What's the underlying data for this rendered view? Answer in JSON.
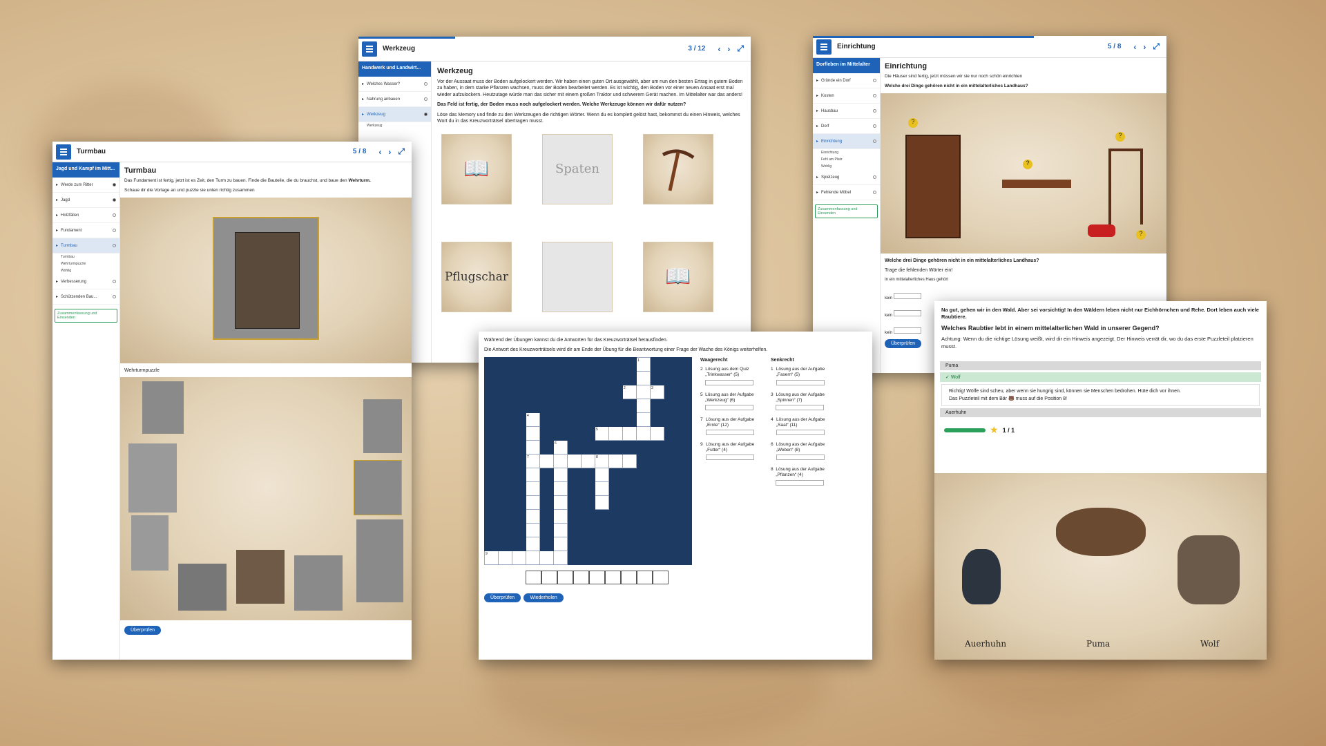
{
  "w1": {
    "title": "Turmbau",
    "counter": "5 / 8",
    "side_top": "Jagd und Kampf im Mitt...",
    "items": [
      "Werde zum Ritter",
      "Jagd",
      "Holzfällen",
      "Fundament",
      "Turmbau",
      "Verbesserung",
      "Schützenden Bau..."
    ],
    "subs": [
      "Turmbau",
      "Wehrturmpuzzle",
      "Wohlig"
    ],
    "summary": "Zusammenfassung und Einsenden",
    "heading": "Turmbau",
    "text1": "Das Fundament ist fertig, jetzt ist es Zeit, den Turm zu bauen. Finde die Bauteile, die du brauchst, und baue den",
    "text1b": "Wehrturm.",
    "text2": "Schaue dir die Vorlage an und puzzle sie unten richtig zusammen",
    "caption": "Wehrturmpuzzle",
    "check": "Überprüfen"
  },
  "w2": {
    "title": "Werkzeug",
    "counter": "3 / 12",
    "side_top": "Handwerk und Landwirt...",
    "items": [
      "Welches Wasser?",
      "Nahrung anbauen",
      "Werkzeug"
    ],
    "subs": [
      "Werkzeug"
    ],
    "heading": "Werkzeug",
    "text1": "Vor der Aussaat muss der Boden aufgelockert werden. Wir haben einen guten Ort ausgewählt, aber um nun den besten Ertrag in gutem Boden zu haben, in dem starke Pflanzen wachsen, muss der Boden bearbeitet werden. Es ist wichtig, den Boden vor einer neuen Ansaat erst mal wieder aufzulockern. Heutzutage würde man das sicher mit einem großen Traktor und schwerem Gerät machen. Im Mittelalter war das anders!",
    "text2": "Das Feld ist fertig, der Boden muss noch aufgelockert werden. Welche Werkzeuge können wir dafür nutzen?",
    "text3": "Löse das Memory und finde zu den Werkzeugen die richtigen Wörter. Wenn du es komplett gelöst hast, bekommst du einen Hinweis, welches Wort du in das Kreuzworträtsel übertragen musst.",
    "card_spaten": "Spaten",
    "card_pflugschar": "Pflugschar"
  },
  "w3": {
    "title": "Einrichtung",
    "counter": "5 / 8",
    "side_top": "Dorfleben im Mittelalter",
    "items": [
      "Gründe ein Dorf",
      "Kosten",
      "Hausbau",
      "Dorf",
      "Einrichtung",
      "Spielzeug",
      "Fehlende Möbel"
    ],
    "subs": [
      "Einrichtung",
      "Fehl am Platz",
      "Wohlig"
    ],
    "summary": "Zusammenfassung und Einsenden",
    "heading": "Einrichtung",
    "text1": "Die Häuser sind fertig, jetzt müssen wir sie nur noch schön einrichten",
    "q": "Welche drei Dinge gehören nicht in ein mittelalterliches Landhaus?",
    "q2": "Welche drei Dinge gehören nicht in ein mittelalterliches Landhaus?",
    "fill": "Trage die fehlenden Wörter ein!",
    "line": "In ein mittelalterliches Haus gehört",
    "kein": "kein",
    "check": "Überprüfen"
  },
  "w4": {
    "text1": "Während der Übungen kannst du die Antworten für das Kreuzworträtsel herausfinden.",
    "text2": "Die Antwort des Kreuzworträtsels wird dir am Ende der Übung für die Beantwortung einer Frage der Wache des Königs weiterhelfen.",
    "across_h": "Waagerecht",
    "down_h": "Senkrecht",
    "across": [
      [
        "2",
        "Lösung aus dem Quiz „Trinkwasser“ (5)"
      ],
      [
        "5",
        "Lösung aus der Aufgabe „Werkzeug“ (6)"
      ],
      [
        "7",
        "Lösung aus der Aufgabe „Ernte“ (12)"
      ],
      [
        "9",
        "Lösung aus der Aufgabe „Futter“ (4)"
      ]
    ],
    "down": [
      [
        "1",
        "Lösung aus der Aufgabe „Fasern“ (5)"
      ],
      [
        "3",
        "Lösung aus der Aufgabe „Spinnen“ (7)"
      ],
      [
        "4",
        "Lösung aus der Aufgabe „Saat“ (11)"
      ],
      [
        "6",
        "Lösung aus der Aufgabe „Weben“ (8)"
      ],
      [
        "8",
        "Lösung aus der Aufgabe „Pflanzen“ (4)"
      ]
    ],
    "check": "Überprüfen",
    "retry": "Wiederholen"
  },
  "w5": {
    "intro": "Na gut, gehen wir in den Wald. Aber sei vorsichtig! In den Wäldern leben nicht nur Eichhörnchen und Rehe. Dort leben auch viele Raubtiere.",
    "q": "Welches Raubtier lebt in einem mittelalterlichen Wald in unserer Gegend?",
    "hint": "Achtung: Wenn du die richtige Lösung weißt, wird dir ein Hinweis angezeigt. Der Hinweis verrät dir, wo du das erste Puzzleteil platzieren musst.",
    "opts": [
      "Puma",
      "Wolf",
      "Auerhuhn"
    ],
    "fb": "Richtig! Wölfe sind scheu, aber wenn sie hungrig sind, können sie Menschen bedrohen. Hüte dich vor ihnen.",
    "fb2a": "Das Puzzleteil mit dem Bär",
    "fb2b": "muss auf die Position 8!",
    "score": "1 / 1",
    "labels": [
      "Auerhuhn",
      "Puma",
      "Wolf"
    ]
  }
}
